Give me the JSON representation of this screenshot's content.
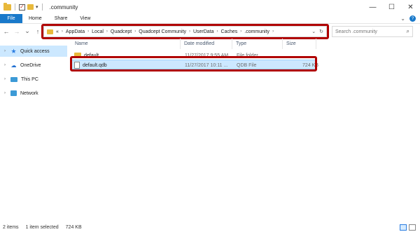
{
  "window": {
    "title": ".community",
    "minimize": "—",
    "maximize": "☐",
    "close": "✕"
  },
  "ribbon": {
    "tabs": [
      "File",
      "Home",
      "Share",
      "View"
    ],
    "expand": "⌄",
    "help": "?"
  },
  "nav": {
    "back": "←",
    "forward": "→",
    "recent": "⌄",
    "up": "↑"
  },
  "address": {
    "prefix": "«",
    "crumbs": [
      "AppData",
      "Local",
      "Quadcept",
      "Quadcept Community",
      "UserData",
      "Caches",
      ".community"
    ],
    "dropdown": "⌄",
    "refresh": "↻"
  },
  "search": {
    "placeholder": "Search .community",
    "icon": "search-icon"
  },
  "sidebar": {
    "items": [
      {
        "label": "Quick access",
        "icon": "star-icon"
      },
      {
        "label": "OneDrive",
        "icon": "cloud-icon"
      },
      {
        "label": "This PC",
        "icon": "computer-icon"
      },
      {
        "label": "Network",
        "icon": "network-icon"
      }
    ]
  },
  "columns": [
    "Name",
    "Date modified",
    "Type",
    "Size"
  ],
  "files": [
    {
      "name": "default",
      "date": "11/27/2017 9:55 AM",
      "type": "File folder",
      "size": ""
    },
    {
      "name": "default.qdb",
      "date": "11/27/2017 10:11 ...",
      "type": "QDB File",
      "size": "724 KB"
    }
  ],
  "status": {
    "items": "2 items",
    "selected": "1 item selected",
    "size": "724 KB"
  },
  "colors": {
    "accent": "#1979ca",
    "selection": "#cce8ff",
    "highlight_box": "#b00000",
    "folder": "#e8b93c"
  }
}
